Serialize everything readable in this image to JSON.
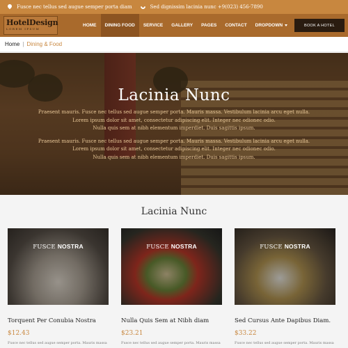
{
  "topbar": {
    "address": "Fusce nec tellus sed augue semper porta diam",
    "phone": "Sed dignissim lacinia nunc +9(023) 456-7890"
  },
  "logo": {
    "name": "HotelDesign",
    "tagline": "LOREM IPSUM"
  },
  "nav": {
    "items": [
      "HOME",
      "DINING FOOD",
      "SERVICE",
      "GALLERY",
      "PAGES",
      "CONTACT",
      "DROPDOWN"
    ],
    "active_index": 1,
    "cta": "BOOK A HOTEL"
  },
  "breadcrumb": {
    "home": "Home",
    "separator": "|",
    "current": "Dining & Food"
  },
  "hero": {
    "title": "Lacinia Nunc",
    "para1": [
      "Praesent mauris. Fusce nec tellus sed augue semper porta. Mauris massa. Vestibulum lacinia arcu eget nulla.",
      "Lorem ipsum dolor sit amet, consectetur adipiscing elit. Integer nec odionec odio.",
      "Nulla quis sem at nibh elementum imperdiet. Duis sagittis ipsum."
    ],
    "para2": [
      "Praesent mauris. Fusce nec tellus sed augue semper porta. Mauris massa. Vestibulum lacinia arcu eget nulla.",
      "Lorem ipsum dolor sit amet, consectetur adipiscing elit. Integer nec odionec odio.",
      "Nulla quis sem at nibh elementum imperdiet. Duis sagittis ipsum."
    ]
  },
  "section": {
    "title": "Lacinia Nunc"
  },
  "cards": [
    {
      "label_a": "FUSCE",
      "label_b": "NOSTRA",
      "title": "Torquent Per Conubia Nostra",
      "price": "$12.43",
      "desc": "Fusce nec tellus sed augue semper porta. Mauris massa"
    },
    {
      "label_a": "FUSCE",
      "label_b": "NOSTRA",
      "title": "Nulla Quis Sem at Nibh diam",
      "price": "$23.21",
      "desc": "Fusce nec tellus sed augue semper porta. Mauris massa"
    },
    {
      "label_a": "FUSCE",
      "label_b": "NOSTRA",
      "title": "Sed Cursus Ante Dapibus Diam.",
      "price": "$33.22",
      "desc": "Fusce nec tellus sed augue semper porta. Mauris massa"
    }
  ],
  "colors": {
    "accent": "#c8873f",
    "nav": "#a96a2c",
    "cta": "#2a1c10"
  }
}
